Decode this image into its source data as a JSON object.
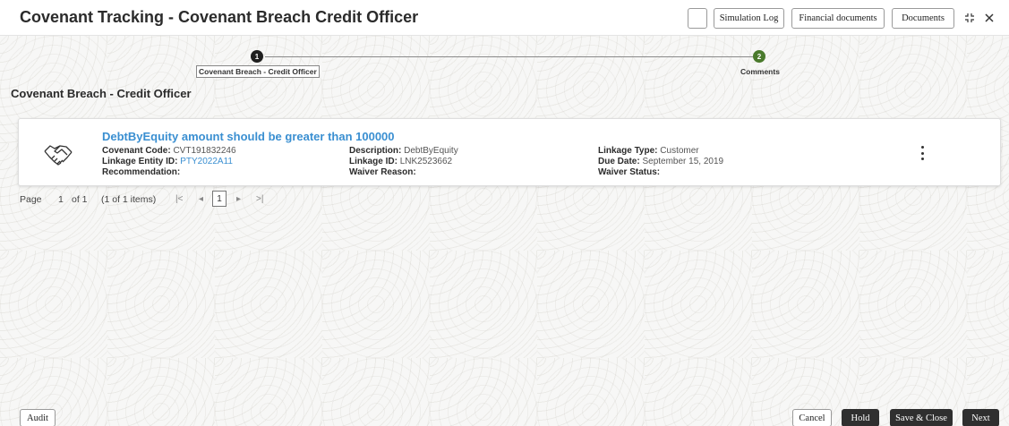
{
  "header": {
    "title": "Covenant Tracking - Covenant Breach Credit Officer",
    "buttons": {
      "simulation_log": "Simulation Log",
      "financial_documents": "Financial documents",
      "documents": "Documents"
    }
  },
  "stepper": {
    "steps": [
      {
        "number": "1",
        "label": "Covenant Breach - Credit Officer",
        "color": "#1f1f1f"
      },
      {
        "number": "2",
        "label": "Comments",
        "color": "#4a7a2c"
      }
    ]
  },
  "section_title": "Covenant Breach - Credit Officer",
  "card": {
    "title": "DebtByEquity amount should be greater than 100000",
    "covenant_code": {
      "label": "Covenant Code:",
      "value": "CVT191832246"
    },
    "linkage_entity_id": {
      "label": "Linkage Entity ID:",
      "value": "PTY2022A11"
    },
    "recommendation": {
      "label": "Recommendation:",
      "value": ""
    },
    "description": {
      "label": "Description:",
      "value": "DebtByEquity"
    },
    "linkage_id": {
      "label": "Linkage ID:",
      "value": "LNK2523662"
    },
    "waiver_reason": {
      "label": "Waiver Reason:",
      "value": ""
    },
    "linkage_type": {
      "label": "Linkage Type:",
      "value": "Customer"
    },
    "due_date": {
      "label": "Due Date:",
      "value": "September 15, 2019"
    },
    "waiver_status": {
      "label": "Waiver Status:",
      "value": ""
    }
  },
  "pagination": {
    "page_label": "Page",
    "page_number": "1",
    "of_label": "of 1",
    "items_label": "(1 of 1 items)",
    "first": "|<",
    "prev": "◂",
    "current": "1",
    "next": "▸",
    "last": ">|"
  },
  "footer": {
    "audit": "Audit",
    "cancel": "Cancel",
    "hold": "Hold",
    "save_close": "Save & Close",
    "next": "Next"
  },
  "colors": {
    "link": "#3a8fd1",
    "step_active": "#1f1f1f",
    "step_done": "#4a7a2c",
    "dark_button": "#2f2f2f"
  }
}
